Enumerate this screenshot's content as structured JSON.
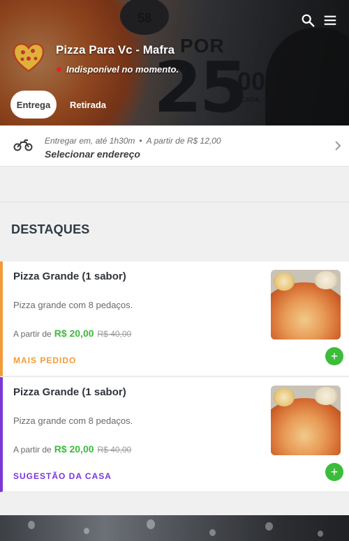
{
  "header": {
    "promo_text": {
      "badge": "58",
      "por": "POR",
      "big": "25",
      "cents": "00",
      "cada": "*CADA"
    },
    "shop_name": "Pizza Para Vc - Mafra",
    "status": "Indisponível no momento.",
    "tabs": [
      {
        "label": "Entrega",
        "active": true
      },
      {
        "label": "Retirada",
        "active": false
      }
    ],
    "icons": {
      "search": "search-icon",
      "menu": "menu-icon",
      "logo": "heart-pizza-logo"
    }
  },
  "address": {
    "delivery_time": "Entregar em, até 1h30m",
    "separator": "•",
    "min_order": "A partir de R$ 12,00",
    "select_label": "Selecionar endereço"
  },
  "section": {
    "title": "DESTAQUES"
  },
  "products": [
    {
      "title": "Pizza Grande (1 sabor)",
      "description": "Pizza grande com 8 pedaços.",
      "price_prefix": "A partir de",
      "price": "R$ 20,00",
      "old_price": "R$ 40,00",
      "tag": "MAIS PEDIDO",
      "accent": "#f29b38"
    },
    {
      "title": "Pizza Grande (1 sabor)",
      "description": "Pizza grande com 8 pedaços.",
      "price_prefix": "A partir de",
      "price": "R$ 20,00",
      "old_price": "R$ 40,00",
      "tag": "SUGESTÃO DA CASA",
      "accent": "#7a36d6"
    }
  ],
  "colors": {
    "green": "#3cbc3b",
    "status_red": "#e5232b"
  }
}
